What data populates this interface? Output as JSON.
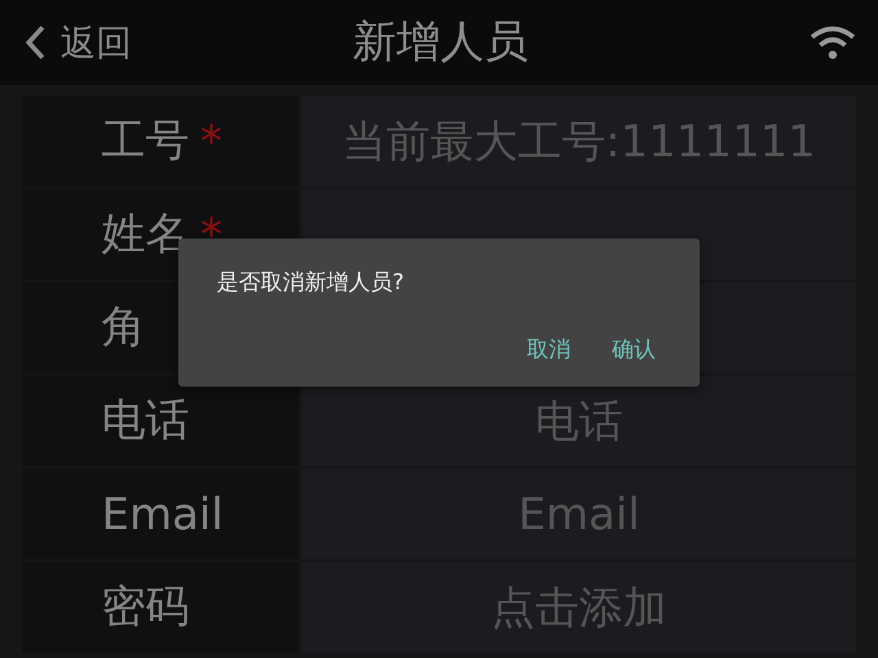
{
  "header": {
    "back_label": "返回",
    "title": "新增人员"
  },
  "form": {
    "rows": [
      {
        "label": "工号",
        "required_mark": "*",
        "placeholder": "当前最大工号:1111111"
      },
      {
        "label": "姓名",
        "required_mark": "*"
      },
      {
        "label": "角"
      },
      {
        "label": "电话",
        "placeholder": "电话"
      },
      {
        "label": "Email",
        "placeholder": "Email"
      },
      {
        "label": "密码",
        "placeholder": "点击添加"
      }
    ]
  },
  "dialog": {
    "message": "是否取消新增人员?",
    "buttons": [
      "取消",
      "确认"
    ]
  }
}
